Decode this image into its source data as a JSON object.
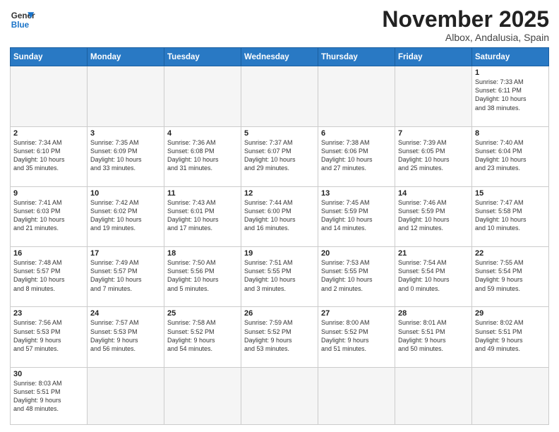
{
  "logo": {
    "line1": "General",
    "line2": "Blue"
  },
  "title": "November 2025",
  "location": "Albox, Andalusia, Spain",
  "weekdays": [
    "Sunday",
    "Monday",
    "Tuesday",
    "Wednesday",
    "Thursday",
    "Friday",
    "Saturday"
  ],
  "weeks": [
    [
      {
        "day": "",
        "info": ""
      },
      {
        "day": "",
        "info": ""
      },
      {
        "day": "",
        "info": ""
      },
      {
        "day": "",
        "info": ""
      },
      {
        "day": "",
        "info": ""
      },
      {
        "day": "",
        "info": ""
      },
      {
        "day": "1",
        "info": "Sunrise: 7:33 AM\nSunset: 6:11 PM\nDaylight: 10 hours\nand 38 minutes."
      }
    ],
    [
      {
        "day": "2",
        "info": "Sunrise: 7:34 AM\nSunset: 6:10 PM\nDaylight: 10 hours\nand 35 minutes."
      },
      {
        "day": "3",
        "info": "Sunrise: 7:35 AM\nSunset: 6:09 PM\nDaylight: 10 hours\nand 33 minutes."
      },
      {
        "day": "4",
        "info": "Sunrise: 7:36 AM\nSunset: 6:08 PM\nDaylight: 10 hours\nand 31 minutes."
      },
      {
        "day": "5",
        "info": "Sunrise: 7:37 AM\nSunset: 6:07 PM\nDaylight: 10 hours\nand 29 minutes."
      },
      {
        "day": "6",
        "info": "Sunrise: 7:38 AM\nSunset: 6:06 PM\nDaylight: 10 hours\nand 27 minutes."
      },
      {
        "day": "7",
        "info": "Sunrise: 7:39 AM\nSunset: 6:05 PM\nDaylight: 10 hours\nand 25 minutes."
      },
      {
        "day": "8",
        "info": "Sunrise: 7:40 AM\nSunset: 6:04 PM\nDaylight: 10 hours\nand 23 minutes."
      }
    ],
    [
      {
        "day": "9",
        "info": "Sunrise: 7:41 AM\nSunset: 6:03 PM\nDaylight: 10 hours\nand 21 minutes."
      },
      {
        "day": "10",
        "info": "Sunrise: 7:42 AM\nSunset: 6:02 PM\nDaylight: 10 hours\nand 19 minutes."
      },
      {
        "day": "11",
        "info": "Sunrise: 7:43 AM\nSunset: 6:01 PM\nDaylight: 10 hours\nand 17 minutes."
      },
      {
        "day": "12",
        "info": "Sunrise: 7:44 AM\nSunset: 6:00 PM\nDaylight: 10 hours\nand 16 minutes."
      },
      {
        "day": "13",
        "info": "Sunrise: 7:45 AM\nSunset: 5:59 PM\nDaylight: 10 hours\nand 14 minutes."
      },
      {
        "day": "14",
        "info": "Sunrise: 7:46 AM\nSunset: 5:59 PM\nDaylight: 10 hours\nand 12 minutes."
      },
      {
        "day": "15",
        "info": "Sunrise: 7:47 AM\nSunset: 5:58 PM\nDaylight: 10 hours\nand 10 minutes."
      }
    ],
    [
      {
        "day": "16",
        "info": "Sunrise: 7:48 AM\nSunset: 5:57 PM\nDaylight: 10 hours\nand 8 minutes."
      },
      {
        "day": "17",
        "info": "Sunrise: 7:49 AM\nSunset: 5:57 PM\nDaylight: 10 hours\nand 7 minutes."
      },
      {
        "day": "18",
        "info": "Sunrise: 7:50 AM\nSunset: 5:56 PM\nDaylight: 10 hours\nand 5 minutes."
      },
      {
        "day": "19",
        "info": "Sunrise: 7:51 AM\nSunset: 5:55 PM\nDaylight: 10 hours\nand 3 minutes."
      },
      {
        "day": "20",
        "info": "Sunrise: 7:53 AM\nSunset: 5:55 PM\nDaylight: 10 hours\nand 2 minutes."
      },
      {
        "day": "21",
        "info": "Sunrise: 7:54 AM\nSunset: 5:54 PM\nDaylight: 10 hours\nand 0 minutes."
      },
      {
        "day": "22",
        "info": "Sunrise: 7:55 AM\nSunset: 5:54 PM\nDaylight: 9 hours\nand 59 minutes."
      }
    ],
    [
      {
        "day": "23",
        "info": "Sunrise: 7:56 AM\nSunset: 5:53 PM\nDaylight: 9 hours\nand 57 minutes."
      },
      {
        "day": "24",
        "info": "Sunrise: 7:57 AM\nSunset: 5:53 PM\nDaylight: 9 hours\nand 56 minutes."
      },
      {
        "day": "25",
        "info": "Sunrise: 7:58 AM\nSunset: 5:52 PM\nDaylight: 9 hours\nand 54 minutes."
      },
      {
        "day": "26",
        "info": "Sunrise: 7:59 AM\nSunset: 5:52 PM\nDaylight: 9 hours\nand 53 minutes."
      },
      {
        "day": "27",
        "info": "Sunrise: 8:00 AM\nSunset: 5:52 PM\nDaylight: 9 hours\nand 51 minutes."
      },
      {
        "day": "28",
        "info": "Sunrise: 8:01 AM\nSunset: 5:51 PM\nDaylight: 9 hours\nand 50 minutes."
      },
      {
        "day": "29",
        "info": "Sunrise: 8:02 AM\nSunset: 5:51 PM\nDaylight: 9 hours\nand 49 minutes."
      }
    ],
    [
      {
        "day": "30",
        "info": "Sunrise: 8:03 AM\nSunset: 5:51 PM\nDaylight: 9 hours\nand 48 minutes."
      },
      {
        "day": "",
        "info": ""
      },
      {
        "day": "",
        "info": ""
      },
      {
        "day": "",
        "info": ""
      },
      {
        "day": "",
        "info": ""
      },
      {
        "day": "",
        "info": ""
      },
      {
        "day": "",
        "info": ""
      }
    ]
  ]
}
